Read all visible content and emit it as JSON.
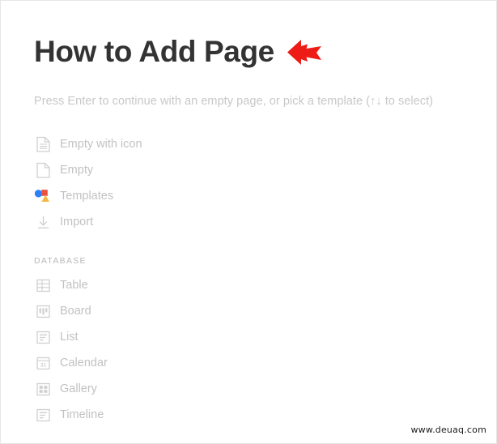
{
  "page": {
    "title": "How to Add Page",
    "subtitle": "Press Enter to continue with an empty page, or pick a template (↑↓ to select)",
    "watermark": "www.deuaq.com",
    "arrow_icon": "red-left-arrow-icon",
    "arrow_color": "#ee1c16",
    "title_color": "#333333",
    "muted_color": "#c2c2c2"
  },
  "menu": {
    "primary_items": [
      {
        "label": "Empty with icon",
        "icon": "document-lines-icon"
      },
      {
        "label": "Empty",
        "icon": "document-blank-icon"
      },
      {
        "label": "Templates",
        "icon": "templates-shapes-icon"
      },
      {
        "label": "Import",
        "icon": "download-import-icon"
      }
    ],
    "database_section": {
      "heading": "DATABASE",
      "items": [
        {
          "label": "Table",
          "icon": "table-grid-icon"
        },
        {
          "label": "Board",
          "icon": "board-columns-icon"
        },
        {
          "label": "List",
          "icon": "list-lines-icon"
        },
        {
          "label": "Calendar",
          "icon": "calendar-31-icon",
          "icon_text": "31"
        },
        {
          "label": "Gallery",
          "icon": "gallery-grid-icon"
        },
        {
          "label": "Timeline",
          "icon": "timeline-lines-icon"
        }
      ]
    }
  },
  "colors": {
    "templates_blue": "#2d7ff9",
    "templates_red": "#e8523f",
    "templates_yellow": "#f5b841",
    "icon_stroke": "#cfcfcf"
  }
}
